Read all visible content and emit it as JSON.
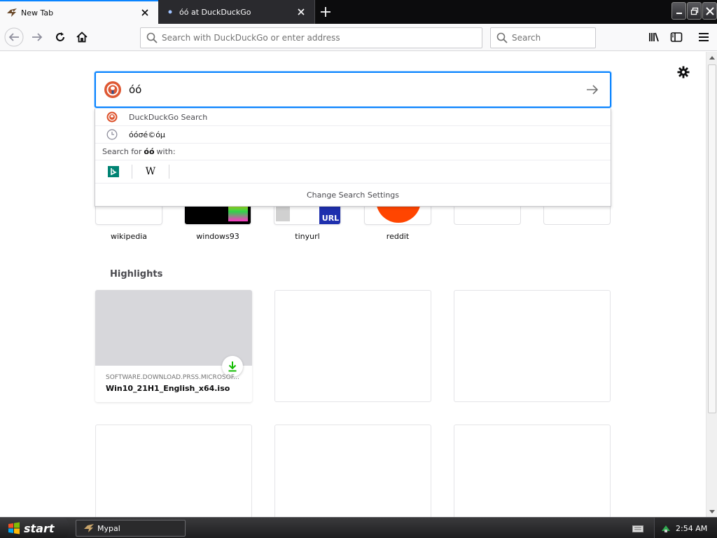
{
  "browser": {
    "tabs": [
      {
        "title": "New Tab",
        "active": true
      },
      {
        "title": "óó at DuckDuckGo",
        "active": false
      }
    ],
    "urlbar": {
      "placeholder": "Search with DuckDuckGo or enter address",
      "value": ""
    },
    "searchbar": {
      "placeholder": "Search",
      "value": ""
    },
    "accent_color": "#0a84ff"
  },
  "newtab": {
    "search": {
      "value": "óó",
      "suggestions": [
        {
          "label": "DuckDuckGo Search",
          "icon": "duckduckgo-icon"
        },
        {
          "label": "óóσé©óµ",
          "icon": "history-clock-icon"
        }
      ],
      "search_for_prefix": "Search for",
      "search_for_term": "óó",
      "search_for_suffix": "with:",
      "engines": [
        {
          "name": "Bing",
          "icon": "bing-icon"
        },
        {
          "name": "Wikipedia",
          "icon": "wikipedia-icon"
        }
      ],
      "change_settings": "Change Search Settings"
    },
    "top_sites": [
      {
        "label": "wikipedia"
      },
      {
        "label": "windows93"
      },
      {
        "label": "tinyurl"
      },
      {
        "label": "reddit"
      },
      {
        "label": ""
      },
      {
        "label": ""
      }
    ],
    "highlights_title": "Highlights",
    "highlights": [
      {
        "source": "SOFTWARE.DOWNLOAD.PRSS.MICROSOF...",
        "name": "Win10_21H1_English_x64.iso",
        "type": "download"
      }
    ]
  },
  "taskbar": {
    "start_label": "start",
    "items": [
      {
        "label": "Mypal"
      }
    ],
    "clock": "2:54 AM"
  }
}
